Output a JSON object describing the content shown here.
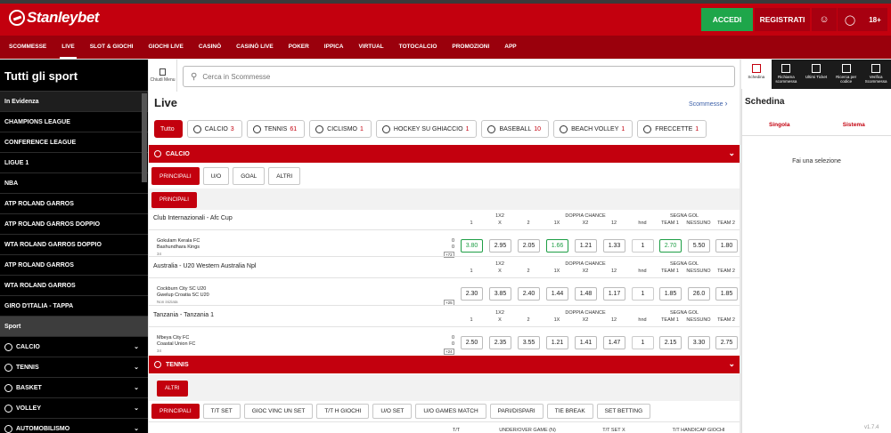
{
  "brand": {
    "name": "Stanleybet"
  },
  "header": {
    "accedi": "ACCEDI",
    "registrati": "REGISTRATI",
    "age": "18+"
  },
  "nav": [
    "SCOMMESSE",
    "LIVE",
    "SLOT & GIOCHI",
    "GIOCHI LIVE",
    "CASINÒ",
    "CASINÒ LIVE",
    "POKER",
    "IPPICA",
    "VIRTUAL",
    "TOTOCALCIO",
    "PROMOZIONI",
    "APP"
  ],
  "sidebar": {
    "title": "Tutti gli sport",
    "evidenza_header": "In Evidenza",
    "items": [
      "CHAMPIONS LEAGUE",
      "CONFERENCE LEAGUE",
      "LIGUE 1",
      "NBA",
      "ATP ROLAND GARROS",
      "ATP ROLAND GARROS DOPPIO",
      "WTA ROLAND GARROS DOPPIO",
      "ATP ROLAND GARROS",
      "WTA ROLAND GARROS",
      "GIRO D'ITALIA - TAPPA"
    ],
    "sport_header": "Sport",
    "sports": [
      "CALCIO",
      "TENNIS",
      "BASKET",
      "VOLLEY",
      "AUTOMOBILISMO"
    ]
  },
  "main": {
    "chiudi": "Chiudi Menu",
    "search_placeholder": "Cerca in Scommesse",
    "title": "Live",
    "scommesse_link": "Scommesse",
    "filters": [
      {
        "label": "Tutto",
        "count": ""
      },
      {
        "label": "CALCIO",
        "count": "3"
      },
      {
        "label": "TENNIS",
        "count": "61"
      },
      {
        "label": "CICLISMO",
        "count": "1"
      },
      {
        "label": "HOCKEY SU GHIACCIO",
        "count": "1"
      },
      {
        "label": "BASEBALL",
        "count": "10"
      },
      {
        "label": "BEACH VOLLEY",
        "count": "1"
      },
      {
        "label": "FRECCETTE",
        "count": "1"
      }
    ],
    "calcio": {
      "section": "CALCIO",
      "tabs": [
        "PRINCIPALI",
        "U/O",
        "GOAL",
        "ALTRI"
      ],
      "subtab": "PRINCIPALI",
      "col_groups": [
        "1X2",
        "DOPPIA CHANCE",
        "SEGNA GOL"
      ],
      "cols": [
        "1",
        "X",
        "2",
        "1X",
        "X2",
        "12",
        "hnd",
        "TEAM 1",
        "NESSUNO",
        "TEAM 2"
      ],
      "matches": [
        {
          "league": "Club Internazionali - Afc Cup",
          "team1": "Gokulam Kerala FC",
          "team2": "Bashundhara Kings",
          "minute": "34",
          "score1": "0",
          "score2": "0",
          "more": "+72",
          "odds": [
            "3.80",
            "2.95",
            "2.05",
            "1.66",
            "1.21",
            "1.33",
            "1",
            "2.70",
            "5.50",
            "1.80"
          ]
        },
        {
          "league": "Australia - U20 Western Australia Npl",
          "team1": "Cockburn City SC U20",
          "team2": "Gwelup Croatia SC U20",
          "minute": "Non iniziata",
          "score1": "",
          "score2": "",
          "more": "+25",
          "odds": [
            "2.30",
            "3.85",
            "2.40",
            "1.44",
            "1.48",
            "1.17",
            "1",
            "1.85",
            "26.0",
            "1.85"
          ]
        },
        {
          "league": "Tanzania - Tanzania 1",
          "team1": "Mbeya City FC",
          "team2": "Coastal Union FC",
          "minute": "34",
          "score1": "0",
          "score2": "0",
          "more": "+24",
          "odds": [
            "2.50",
            "2.35",
            "3.55",
            "1.21",
            "1.41",
            "1.47",
            "1",
            "2.15",
            "3.30",
            "2.75"
          ]
        }
      ]
    },
    "tennis": {
      "section": "TENNIS",
      "subtab": "ALTRI",
      "tabs": [
        "PRINCIPALI",
        "T/T SET",
        "GIOC VINC UN SET",
        "T/T H GIOCHI",
        "U/O SET",
        "U/O GAMES MATCH",
        "PARI/DISPARI",
        "TIE BREAK",
        "SET BETTING"
      ],
      "col_groups": [
        "T/T",
        "UNDER/OVER GAME (N)",
        "T/T SET X",
        "T/T HANDICAP GIOCHI"
      ]
    }
  },
  "right": {
    "icons": [
      {
        "label": "Schedina",
        "icon": "ticket-icon"
      },
      {
        "label": "Richiama scommessa",
        "icon": "recall-icon"
      },
      {
        "label": "Ultimi Ticket",
        "icon": "last-ticket-icon"
      },
      {
        "label": "Ricerca per codice",
        "icon": "code-search-icon"
      },
      {
        "label": "Verifica Scommessa",
        "icon": "verify-icon"
      }
    ],
    "title": "Schedina",
    "tabs": [
      "Singola",
      "Sistema"
    ],
    "empty": "Fai una selezione",
    "version": "v1.7.4"
  }
}
